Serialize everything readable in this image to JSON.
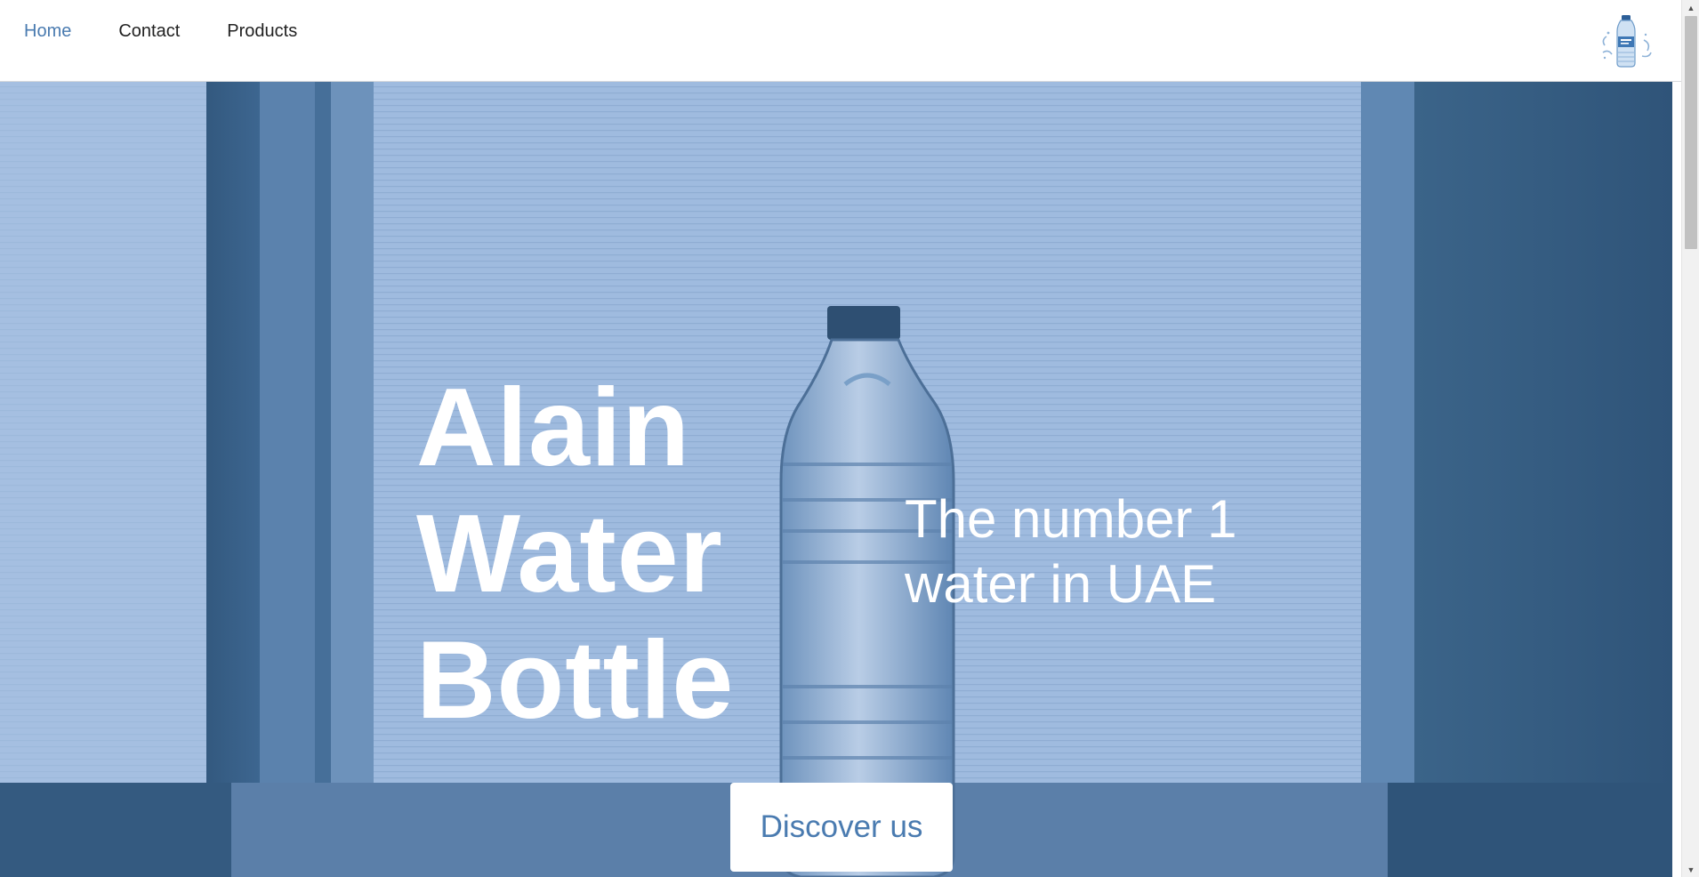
{
  "nav": {
    "items": [
      {
        "label": "Home",
        "active": true
      },
      {
        "label": "Contact",
        "active": false
      },
      {
        "label": "Products",
        "active": false
      }
    ]
  },
  "hero": {
    "title_lines": [
      "Alain",
      "Water",
      "Bottle"
    ],
    "subtitle_lines": [
      "The number 1",
      "water in UAE"
    ],
    "cta_label": "Discover us"
  },
  "icons": {
    "logo": "water-bottle-logo-icon",
    "scroll_up": "scroll-up-arrow-icon",
    "scroll_down": "scroll-down-arrow-icon"
  },
  "colors": {
    "accent": "#4a7bb0",
    "hero_overlay": "#9cb8dc",
    "hero_dark": "#2f5479",
    "text_light": "#ffffff"
  }
}
